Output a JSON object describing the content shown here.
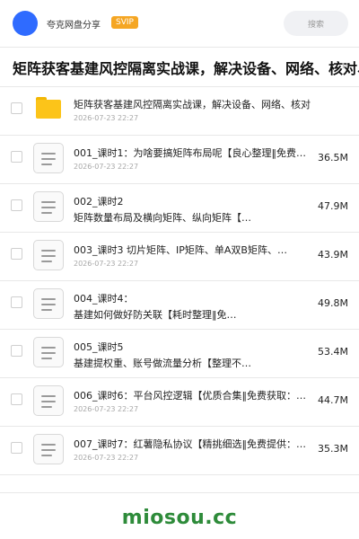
{
  "header": {
    "username": "夸克网盘分享",
    "badge": "SVIP",
    "search_placeholder": "搜索"
  },
  "share": {
    "title": "矩阵获客基建风控隔离实战课，解决设备、网络、核对、卡",
    "ghost_size": "M"
  },
  "files": [
    {
      "type": "folder",
      "name": "矩阵获客基建风控隔离实战课，解决设备、网络、核对、…",
      "date": "2026-07-23 22:27",
      "size": ""
    },
    {
      "type": "file",
      "name": "001_课时1：为啥要搞矩阵布局呢【良心整理‖免费…",
      "date": "2026-07-23 22:27",
      "size": "36.5M"
    },
    {
      "type": "file",
      "name": "002_课时2",
      "name2": "矩阵数量布局及横向矩阵、纵向矩阵【…",
      "date": "",
      "size": "47.9M"
    },
    {
      "type": "file",
      "name": "003_课时3 切片矩阵、IP矩阵、单A双B矩阵、…",
      "date": "2026-07-23 22:27",
      "size": "43.9M"
    },
    {
      "type": "file",
      "name": "004_课时4：",
      "name2": "基建如何做好防关联【耗时整理‖免…",
      "date": "",
      "size": "49.8M"
    },
    {
      "type": "file",
      "name": "005_课时5",
      "name2": "基建提权重、账号做流量分析【整理不…",
      "date": "",
      "size": "53.4M"
    },
    {
      "type": "file",
      "name": "006_课时6：平台风控逻辑【优质合集‖免费获取：…",
      "date": "2026-07-23 22:27",
      "size": "44.7M"
    },
    {
      "type": "file",
      "name": "007_课时7：红薯隐私协议【精挑细选‖免费提供：…",
      "date": "2026-07-23 22:27",
      "size": "35.3M"
    }
  ],
  "watermark": "miosou.cc",
  "colors": {
    "accent": "#2f6bff",
    "badge": "#f5a623",
    "folder": "#fcc419",
    "watermark": "#2e8b3a"
  }
}
